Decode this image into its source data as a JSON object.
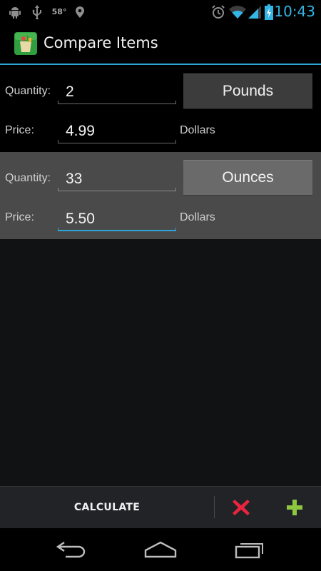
{
  "status_bar": {
    "temperature": "58°",
    "clock": "10:43",
    "icons": [
      "android-debug-icon",
      "usb-icon",
      "location-icon",
      "alarm-icon",
      "wifi-icon",
      "signal-icon",
      "battery-charging-icon"
    ]
  },
  "action_bar": {
    "title": "Compare Items",
    "app_icon": "grocery-bag-icon"
  },
  "items": [
    {
      "quantity_label": "Quantity:",
      "quantity_value": "2",
      "unit_button": "Pounds",
      "price_label": "Price:",
      "price_value": "4.99",
      "currency_label": "Dollars"
    },
    {
      "quantity_label": "Quantity:",
      "quantity_value": "33",
      "unit_button": "Ounces",
      "price_label": "Price:",
      "price_value": "5.50",
      "currency_label": "Dollars"
    }
  ],
  "bottom_bar": {
    "calculate_label": "CALCULATE",
    "delete_icon": "red-x-icon",
    "add_icon": "green-plus-icon"
  },
  "nav_bar": {
    "icons": [
      "back-icon",
      "home-icon",
      "recent-apps-icon"
    ]
  },
  "colors": {
    "accent": "#33b5e5",
    "selected_item_bg": "#4a4a4a",
    "delete": "#e8243f",
    "add": "#8dc63f"
  }
}
